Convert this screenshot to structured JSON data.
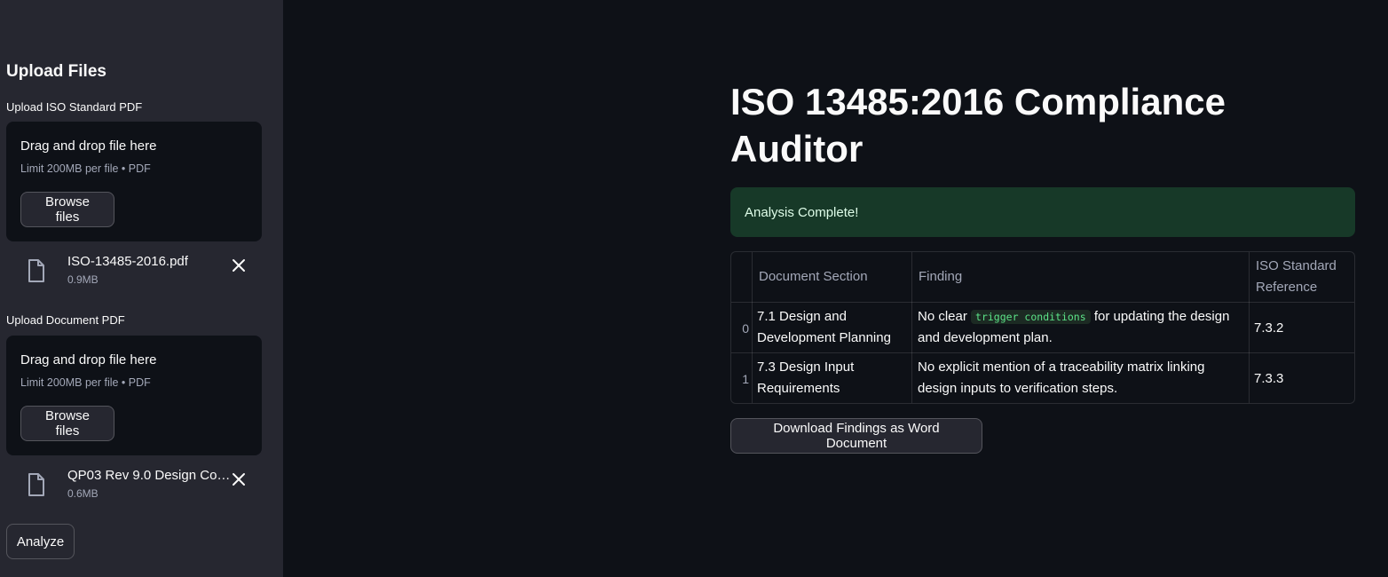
{
  "sidebar": {
    "title": "Upload Files",
    "uploaders": [
      {
        "label": "Upload ISO Standard PDF",
        "drop_text": "Drag and drop file here",
        "limit_text": "Limit 200MB per file • PDF",
        "browse_label": "Browse files",
        "file": {
          "name": "ISO-13485-2016.pdf",
          "size": "0.9MB"
        }
      },
      {
        "label": "Upload Document PDF",
        "drop_text": "Drag and drop file here",
        "limit_text": "Limit 200MB per file • PDF",
        "browse_label": "Browse files",
        "file": {
          "name": "QP03 Rev 9.0 Design Con…",
          "size": "0.6MB"
        }
      }
    ],
    "analyze_label": "Analyze"
  },
  "main": {
    "title": "ISO 13485:2016 Compliance Auditor",
    "alert": "Analysis Complete!",
    "table": {
      "headers": [
        "",
        "Document Section",
        "Finding",
        "ISO Standard Reference"
      ],
      "rows": [
        {
          "index": "0",
          "section": "7.1 Design and Development Planning",
          "finding_pre": "No clear",
          "finding_code": "trigger conditions",
          "finding_post": "for updating the design and development plan.",
          "reference": "7.3.2"
        },
        {
          "index": "1",
          "section": "7.3 Design Input Requirements",
          "finding": "No explicit mention of a traceability matrix linking design inputs to verification steps.",
          "reference": "7.3.3"
        }
      ]
    },
    "download_label": "Download Findings as Word Document"
  },
  "colors": {
    "background": "#0e1117",
    "sidebar": "#262730",
    "success_bg": "#173928",
    "code_text": "#5ce488"
  },
  "icons": [
    "file-icon",
    "close-icon"
  ]
}
